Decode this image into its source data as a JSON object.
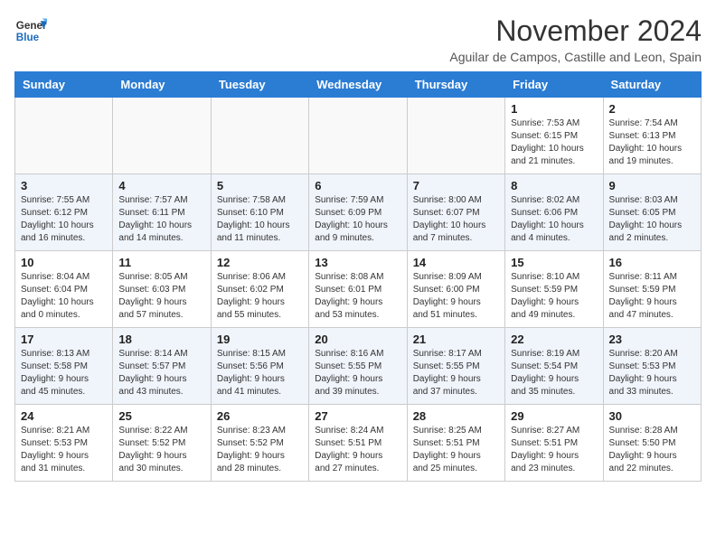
{
  "logo": {
    "line1": "General",
    "line2": "Blue"
  },
  "title": "November 2024",
  "subtitle": "Aguilar de Campos, Castille and Leon, Spain",
  "days_header": [
    "Sunday",
    "Monday",
    "Tuesday",
    "Wednesday",
    "Thursday",
    "Friday",
    "Saturday"
  ],
  "weeks": [
    [
      {
        "day": "",
        "info": ""
      },
      {
        "day": "",
        "info": ""
      },
      {
        "day": "",
        "info": ""
      },
      {
        "day": "",
        "info": ""
      },
      {
        "day": "",
        "info": ""
      },
      {
        "day": "1",
        "info": "Sunrise: 7:53 AM\nSunset: 6:15 PM\nDaylight: 10 hours\nand 21 minutes."
      },
      {
        "day": "2",
        "info": "Sunrise: 7:54 AM\nSunset: 6:13 PM\nDaylight: 10 hours\nand 19 minutes."
      }
    ],
    [
      {
        "day": "3",
        "info": "Sunrise: 7:55 AM\nSunset: 6:12 PM\nDaylight: 10 hours\nand 16 minutes."
      },
      {
        "day": "4",
        "info": "Sunrise: 7:57 AM\nSunset: 6:11 PM\nDaylight: 10 hours\nand 14 minutes."
      },
      {
        "day": "5",
        "info": "Sunrise: 7:58 AM\nSunset: 6:10 PM\nDaylight: 10 hours\nand 11 minutes."
      },
      {
        "day": "6",
        "info": "Sunrise: 7:59 AM\nSunset: 6:09 PM\nDaylight: 10 hours\nand 9 minutes."
      },
      {
        "day": "7",
        "info": "Sunrise: 8:00 AM\nSunset: 6:07 PM\nDaylight: 10 hours\nand 7 minutes."
      },
      {
        "day": "8",
        "info": "Sunrise: 8:02 AM\nSunset: 6:06 PM\nDaylight: 10 hours\nand 4 minutes."
      },
      {
        "day": "9",
        "info": "Sunrise: 8:03 AM\nSunset: 6:05 PM\nDaylight: 10 hours\nand 2 minutes."
      }
    ],
    [
      {
        "day": "10",
        "info": "Sunrise: 8:04 AM\nSunset: 6:04 PM\nDaylight: 10 hours\nand 0 minutes."
      },
      {
        "day": "11",
        "info": "Sunrise: 8:05 AM\nSunset: 6:03 PM\nDaylight: 9 hours\nand 57 minutes."
      },
      {
        "day": "12",
        "info": "Sunrise: 8:06 AM\nSunset: 6:02 PM\nDaylight: 9 hours\nand 55 minutes."
      },
      {
        "day": "13",
        "info": "Sunrise: 8:08 AM\nSunset: 6:01 PM\nDaylight: 9 hours\nand 53 minutes."
      },
      {
        "day": "14",
        "info": "Sunrise: 8:09 AM\nSunset: 6:00 PM\nDaylight: 9 hours\nand 51 minutes."
      },
      {
        "day": "15",
        "info": "Sunrise: 8:10 AM\nSunset: 5:59 PM\nDaylight: 9 hours\nand 49 minutes."
      },
      {
        "day": "16",
        "info": "Sunrise: 8:11 AM\nSunset: 5:59 PM\nDaylight: 9 hours\nand 47 minutes."
      }
    ],
    [
      {
        "day": "17",
        "info": "Sunrise: 8:13 AM\nSunset: 5:58 PM\nDaylight: 9 hours\nand 45 minutes."
      },
      {
        "day": "18",
        "info": "Sunrise: 8:14 AM\nSunset: 5:57 PM\nDaylight: 9 hours\nand 43 minutes."
      },
      {
        "day": "19",
        "info": "Sunrise: 8:15 AM\nSunset: 5:56 PM\nDaylight: 9 hours\nand 41 minutes."
      },
      {
        "day": "20",
        "info": "Sunrise: 8:16 AM\nSunset: 5:55 PM\nDaylight: 9 hours\nand 39 minutes."
      },
      {
        "day": "21",
        "info": "Sunrise: 8:17 AM\nSunset: 5:55 PM\nDaylight: 9 hours\nand 37 minutes."
      },
      {
        "day": "22",
        "info": "Sunrise: 8:19 AM\nSunset: 5:54 PM\nDaylight: 9 hours\nand 35 minutes."
      },
      {
        "day": "23",
        "info": "Sunrise: 8:20 AM\nSunset: 5:53 PM\nDaylight: 9 hours\nand 33 minutes."
      }
    ],
    [
      {
        "day": "24",
        "info": "Sunrise: 8:21 AM\nSunset: 5:53 PM\nDaylight: 9 hours\nand 31 minutes."
      },
      {
        "day": "25",
        "info": "Sunrise: 8:22 AM\nSunset: 5:52 PM\nDaylight: 9 hours\nand 30 minutes."
      },
      {
        "day": "26",
        "info": "Sunrise: 8:23 AM\nSunset: 5:52 PM\nDaylight: 9 hours\nand 28 minutes."
      },
      {
        "day": "27",
        "info": "Sunrise: 8:24 AM\nSunset: 5:51 PM\nDaylight: 9 hours\nand 27 minutes."
      },
      {
        "day": "28",
        "info": "Sunrise: 8:25 AM\nSunset: 5:51 PM\nDaylight: 9 hours\nand 25 minutes."
      },
      {
        "day": "29",
        "info": "Sunrise: 8:27 AM\nSunset: 5:51 PM\nDaylight: 9 hours\nand 23 minutes."
      },
      {
        "day": "30",
        "info": "Sunrise: 8:28 AM\nSunset: 5:50 PM\nDaylight: 9 hours\nand 22 minutes."
      }
    ]
  ]
}
